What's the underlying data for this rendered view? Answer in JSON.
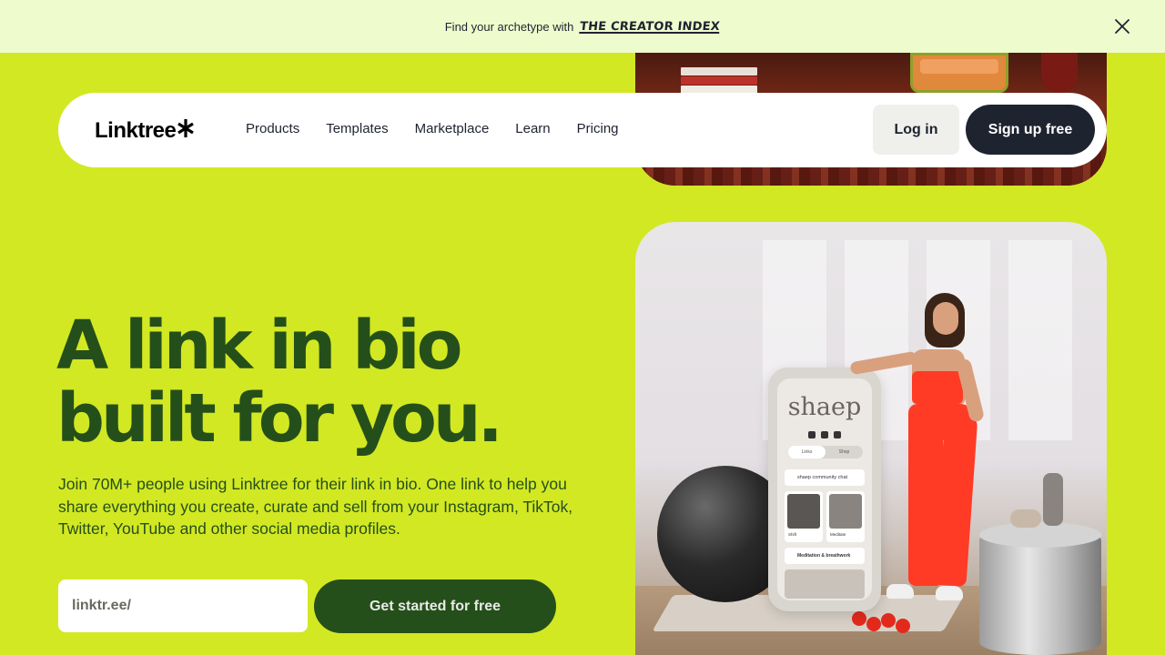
{
  "banner": {
    "text": "Find your archetype with",
    "link": "THE CREATOR INDEX",
    "close_icon": "close-icon"
  },
  "nav": {
    "logo_text": "Linktree",
    "logo_icon": "asterisk-logo-icon",
    "links": [
      "Products",
      "Templates",
      "Marketplace",
      "Learn",
      "Pricing"
    ],
    "login": "Log in",
    "signup": "Sign up free"
  },
  "hero": {
    "title_line1": "A link in bio",
    "title_line2": "built for you.",
    "subtitle": "Join 70M+ people using Linktree for their link in bio. One link to help you share everything you create, curate and sell from your Instagram, TikTok, Twitter, YouTube and other social media profiles.",
    "input_placeholder": "linktr.ee/",
    "cta": "Get started for free"
  },
  "phone": {
    "brand": "shaep",
    "tabs": [
      "Links",
      "Shop"
    ],
    "chat": "shaep community chat",
    "tiles": [
      "Shift",
      "Meditate"
    ],
    "row": "Meditation & breathwork"
  },
  "colors": {
    "background": "#d2e823",
    "banner": "#eefccd",
    "primary_dark": "#254f1a",
    "nav_dark": "#1e2330"
  }
}
